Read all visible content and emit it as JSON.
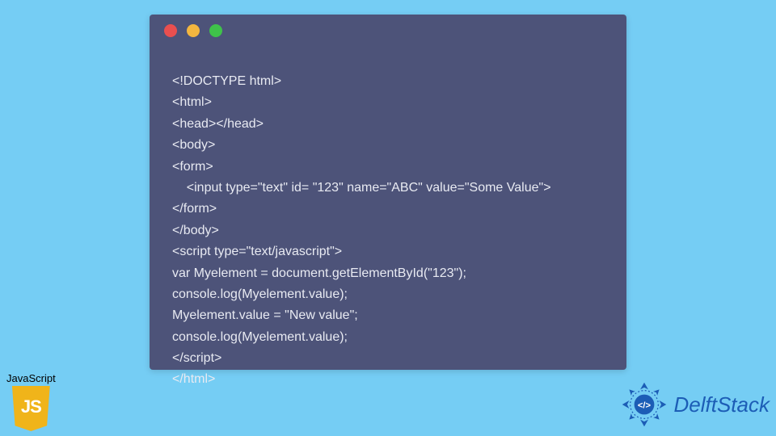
{
  "code": {
    "lines": [
      "<!DOCTYPE html>",
      "<html>",
      "<head></head>",
      "<body>",
      "<form>",
      "    <input type=\"text\" id= \"123\" name=\"ABC\" value=\"Some Value\">",
      "</form>",
      "</body>",
      "<script type=\"text/javascript\">",
      "var Myelement = document.getElementById(\"123\");",
      "console.log(Myelement.value);",
      "Myelement.value = \"New value\";",
      "console.log(Myelement.value);",
      "</script>",
      "</html>"
    ]
  },
  "jsBadge": {
    "label": "JavaScript",
    "iconText": "JS"
  },
  "delft": {
    "text": "DelftStack"
  },
  "window": {
    "dotColors": {
      "red": "#e94f4f",
      "yellow": "#f4b63f",
      "green": "#3fc24a"
    },
    "background": "#4d5379"
  }
}
